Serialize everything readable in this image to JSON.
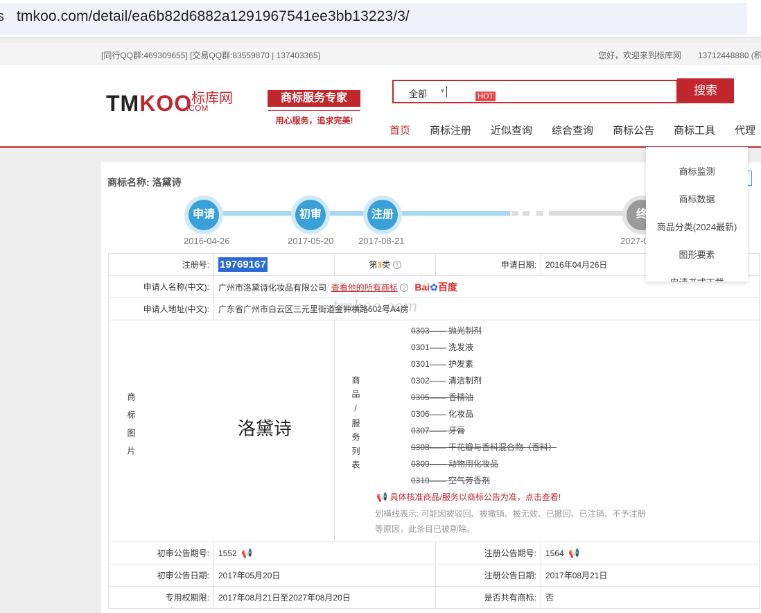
{
  "browser": {
    "url": "tmkoo.com/detail/ea6b82d6882a1291967541ee3bb13223/3/",
    "edge_char": "s"
  },
  "topbar": {
    "qq_groups": "[同行QQ群:469309655] [交易QQ群:83559870 | 137403365]",
    "greeting": "您好，欢迎来到标库网",
    "phone": "13712448880 (积"
  },
  "header": {
    "logo_tm": "TM",
    "logo_koo": "KOO",
    "logo_cn": "标库网",
    "logo_com": ".COM",
    "slogan": "商标服务专家",
    "slogan_sub": "用心服务，追求完美!",
    "search_scope": "全部",
    "search_arrow": "▼",
    "hot_badge": "HOT",
    "search_button": "搜索",
    "nav": [
      "首页",
      "商标注册",
      "近似查询",
      "综合查询",
      "商标公告",
      "商标工具",
      "代理"
    ]
  },
  "dropdown": [
    "商标监测",
    "商标数据",
    "商品分类(2024最新)",
    "图形要素",
    "申请书式下载"
  ],
  "trademark": {
    "name_label": "商标名称:",
    "name": "洛黛诗",
    "timeline": [
      {
        "label": "申请",
        "date": "2016-04-26"
      },
      {
        "label": "初审",
        "date": "2017-05-20"
      },
      {
        "label": "注册",
        "date": "2017-08-21"
      },
      {
        "label": "终",
        "date": "2027-0"
      }
    ],
    "reg_no_label": "注册号:",
    "reg_no": "19769167",
    "class_prefix": "第",
    "class_num": "3",
    "class_suffix": "类",
    "apply_date_label": "申请日期:",
    "apply_date": "2016年04月26日",
    "applicant_label": "申请人名称(中文):",
    "applicant": "广州市洛黛诗化妆品有限公司",
    "applicant_link": "查看他的所有商标",
    "baidu_bai": "Bai",
    "baidu_du": "du",
    "baidu_cn": "百度",
    "address_label": "申请人地址(中文):",
    "address": "广东省广州市白云区三元里街道金钟横路602号A4房",
    "image_label": "商标图片",
    "image_text": "洛黛诗",
    "goods_label": "商品/服务列表",
    "goods": [
      {
        "code": "0303",
        "name": "抛光制剂",
        "struck": true
      },
      {
        "code": "0301",
        "name": "洗发液",
        "struck": false
      },
      {
        "code": "0301",
        "name": "护发素",
        "struck": false
      },
      {
        "code": "0302",
        "name": "清洁制剂",
        "struck": false
      },
      {
        "code": "0305",
        "name": "香精油",
        "struck": true
      },
      {
        "code": "0306",
        "name": "化妆品",
        "struck": false
      },
      {
        "code": "0307",
        "name": "牙膏",
        "struck": true
      },
      {
        "code": "0308",
        "name": "干花瓣与香料混合物（香料）",
        "struck": true
      },
      {
        "code": "0309",
        "name": "动物用化妆品",
        "struck": true
      },
      {
        "code": "0310",
        "name": "空气芳香剂",
        "struck": true
      }
    ],
    "goods_notice": "具体核准商品/服务以商标公告为准，点击查看!",
    "strike_note": "划横线表示: 可能因被驳回、被撤销、被无效、已撤回、已注销、不予注册等原因，此条目已被剔除。",
    "prelim_no_label": "初审公告期号:",
    "prelim_no": "1552",
    "reg_pub_no_label": "注册公告期号:",
    "reg_pub_no": "1564",
    "prelim_date_label": "初审公告日期:",
    "prelim_date": "2017年05月20日",
    "reg_pub_date_label": "注册公告日期:",
    "reg_pub_date": "2017年08月21日",
    "term_label": "专用权期限:",
    "term": "2017年08月21日至2027年08月20日",
    "shared_label": "是否共有商标:",
    "shared": "否",
    "watermark": "tmkoo.com"
  },
  "colors": {
    "brand_red": "#c1272d",
    "timeline_blue": "#3aa0d8",
    "regno_bg": "#2a6ad1"
  }
}
